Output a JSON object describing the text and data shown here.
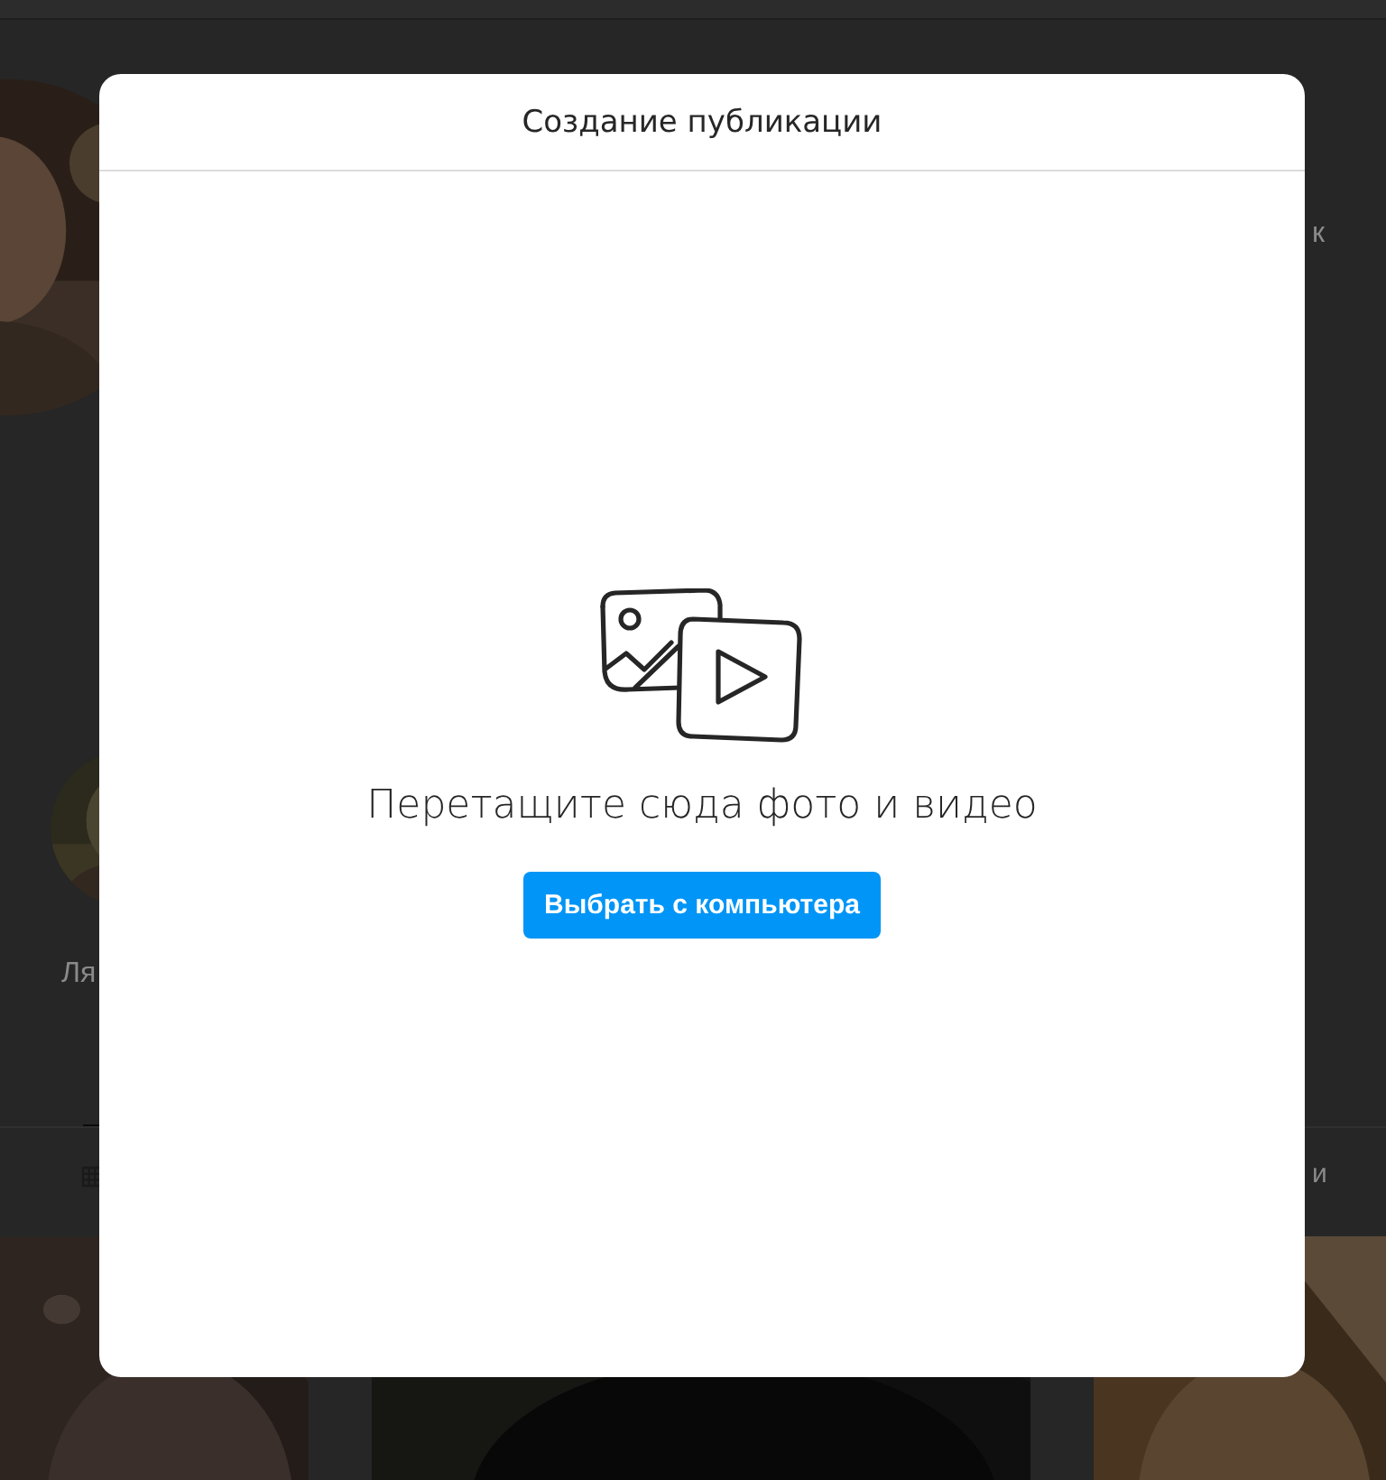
{
  "background": {
    "fragments": [
      {
        "kind": "side-text",
        "text": "к"
      },
      {
        "kind": "name",
        "text": "Ля"
      },
      {
        "kind": "tab",
        "text": "и"
      }
    ]
  },
  "modal": {
    "title": "Создание публикации",
    "prompt": "Перетащите сюда фото и видео",
    "button": "Выбрать с компьютера"
  }
}
